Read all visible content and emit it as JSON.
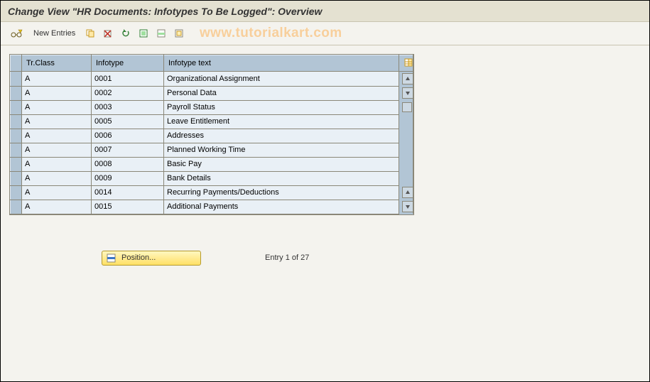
{
  "title": "Change View \"HR Documents: Infotypes To Be Logged\": Overview",
  "toolbar": {
    "new_entries_label": "New Entries"
  },
  "watermark": "www.tutorialkart.com",
  "table": {
    "columns": {
      "tr_class": "Tr.Class",
      "infotype": "Infotype",
      "infotype_text": "Infotype text"
    },
    "rows": [
      {
        "cls": "A",
        "it": "0001",
        "txt": "Organizational Assignment"
      },
      {
        "cls": "A",
        "it": "0002",
        "txt": "Personal Data"
      },
      {
        "cls": "A",
        "it": "0003",
        "txt": "Payroll Status"
      },
      {
        "cls": "A",
        "it": "0005",
        "txt": "Leave Entitlement"
      },
      {
        "cls": "A",
        "it": "0006",
        "txt": "Addresses"
      },
      {
        "cls": "A",
        "it": "0007",
        "txt": "Planned Working Time"
      },
      {
        "cls": "A",
        "it": "0008",
        "txt": "Basic Pay"
      },
      {
        "cls": "A",
        "it": "0009",
        "txt": "Bank Details"
      },
      {
        "cls": "A",
        "it": "0014",
        "txt": "Recurring Payments/Deductions"
      },
      {
        "cls": "A",
        "it": "0015",
        "txt": "Additional Payments"
      }
    ]
  },
  "footer": {
    "position_label": "Position...",
    "entry_text": "Entry 1 of 27"
  }
}
